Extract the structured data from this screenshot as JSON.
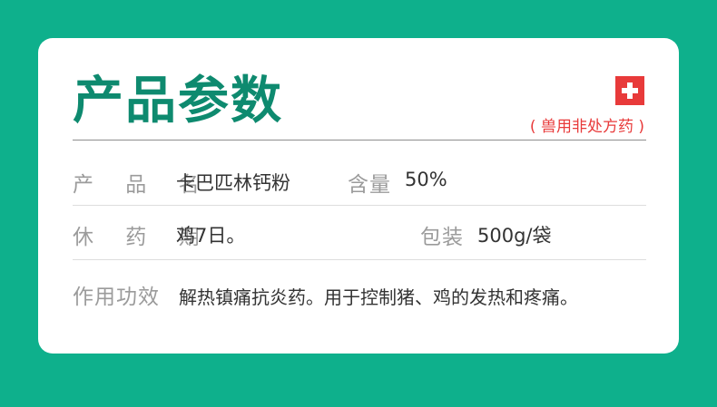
{
  "header": {
    "title": "产品参数",
    "otc_label": "( 兽用非处方药 )",
    "otc_icon": "red-cross-icon"
  },
  "rows": {
    "product_name": {
      "label": "产 品 名",
      "value": "卡巴匹林钙粉"
    },
    "content": {
      "label": "含量",
      "value": "50%"
    },
    "withdrawal": {
      "label": "休 药 期",
      "value": "鸡7日。"
    },
    "package": {
      "label": "包装",
      "value": "500g/袋"
    },
    "function": {
      "label": "作用功效",
      "value": "解热镇痛抗炎药。用于控制猪、鸡的发热和疼痛。"
    }
  },
  "colors": {
    "background": "#0eb08c",
    "title": "#0e8a6f",
    "accent_red": "#e83a3a"
  }
}
